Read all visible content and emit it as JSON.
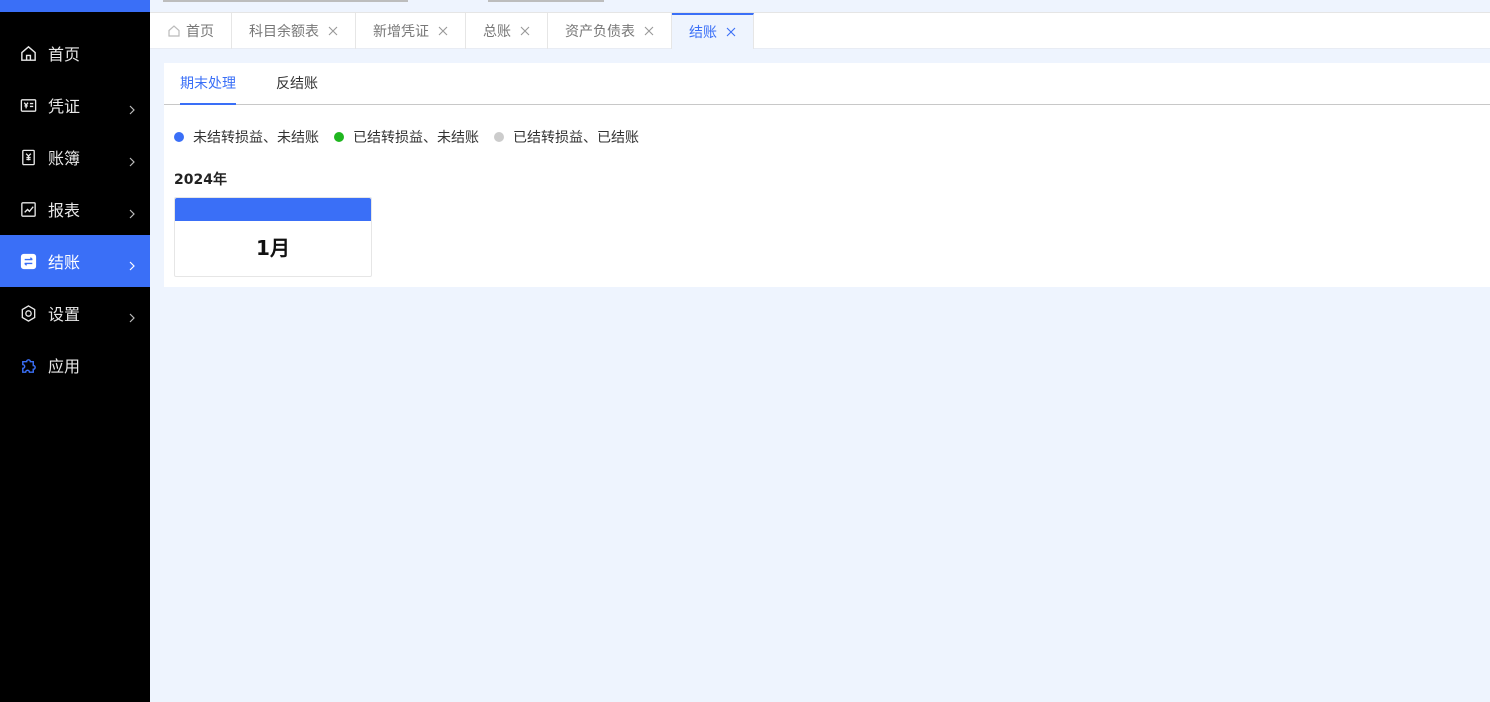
{
  "colors": {
    "accent": "#3a6ff7",
    "sidebar_bg": "#000000",
    "page_bg": "#eef4fe",
    "status_open": "#3a6ff7",
    "status_profit_transferred": "#1fb61f",
    "status_closed": "#cccccc"
  },
  "sidebar": {
    "items": [
      {
        "label": "首页",
        "icon": "home-icon"
      },
      {
        "label": "凭证",
        "icon": "voucher-icon"
      },
      {
        "label": "账簿",
        "icon": "ledger-book-icon"
      },
      {
        "label": "报表",
        "icon": "report-chart-icon"
      },
      {
        "label": "结账",
        "icon": "closing-exchange-icon"
      },
      {
        "label": "设置",
        "icon": "gear-icon"
      },
      {
        "label": "应用",
        "icon": "puzzle-icon"
      }
    ],
    "active": "结账"
  },
  "tabs": [
    {
      "label": "首页",
      "closable": false
    },
    {
      "label": "科目余额表",
      "closable": true
    },
    {
      "label": "新增凭证",
      "closable": true
    },
    {
      "label": "总账",
      "closable": true
    },
    {
      "label": "资产负债表",
      "closable": true
    },
    {
      "label": "结账",
      "closable": true
    }
  ],
  "active_tab": "结账",
  "subtabs": [
    {
      "label": "期末处理"
    },
    {
      "label": "反结账"
    }
  ],
  "legend": [
    {
      "label": "未结转损益、未结账",
      "color": "#3a6ff7"
    },
    {
      "label": "已结转损益、未结账",
      "color": "#1fb61f"
    },
    {
      "label": "已结转损益、已结账",
      "color": "#cccccc"
    }
  ],
  "year": "2024年",
  "months": [
    {
      "label": "1月",
      "status": "未结转损益、未结账"
    }
  ]
}
